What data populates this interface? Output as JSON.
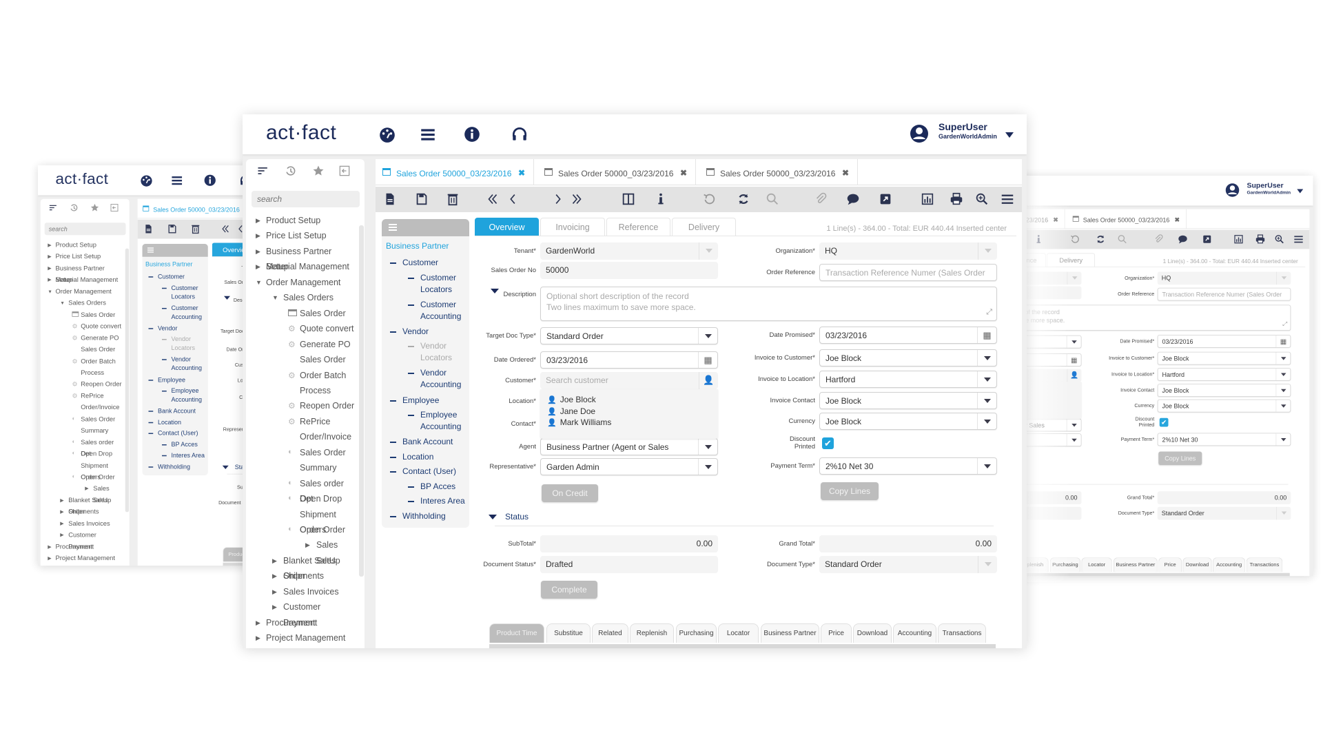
{
  "header": {
    "logo": "act·fact",
    "user_name": "SuperUser",
    "user_role": "GardenWorldAdmin",
    "icons": [
      "dashboard-icon",
      "menu-icon",
      "info-icon",
      "headset-icon"
    ]
  },
  "colors": {
    "accent": "#1fa3dc",
    "navy": "#1b2a5a",
    "button_gray": "#bdbdbd"
  },
  "sidebar": {
    "search_placeholder": "search",
    "tool_icons": [
      "sort-icon",
      "history-icon",
      "star-icon",
      "collapse-icon"
    ],
    "items": [
      {
        "label": "Product Setup",
        "level": 0,
        "icon": "arrow-right"
      },
      {
        "label": "Price List Setup",
        "level": 0,
        "icon": "arrow-right"
      },
      {
        "label": "Business Partner Setup",
        "level": 0,
        "icon": "arrow-right"
      },
      {
        "label": "Material Management",
        "level": 0,
        "icon": "arrow-right"
      },
      {
        "label": "Order Management",
        "level": 0,
        "icon": "arrow-down"
      },
      {
        "label": "Sales Orders",
        "level": 1,
        "icon": "arrow-down"
      },
      {
        "label": "Sales Order",
        "level": 2,
        "icon": "window"
      },
      {
        "label": "Quote convert",
        "level": 2,
        "icon": "gear"
      },
      {
        "label": "Generate PO\nSales Order",
        "level": 2,
        "icon": "gear"
      },
      {
        "label": "Order Batch\nProcess",
        "level": 2,
        "icon": "gear"
      },
      {
        "label": "Reopen Order",
        "level": 2,
        "icon": "gear"
      },
      {
        "label": "RePrice\nOrder/Invoice",
        "level": 2,
        "icon": "gear"
      },
      {
        "label": "Sales Order\nSummary",
        "level": 2,
        "icon": "report"
      },
      {
        "label": "Sales order Det",
        "level": 2,
        "icon": "report"
      },
      {
        "label": "Open Drop\nShipment Orders",
        "level": 2,
        "icon": "report"
      },
      {
        "label": "Open Order",
        "level": 2,
        "icon": "report"
      },
      {
        "label": "Sales SetUp",
        "level": 3,
        "icon": "arrow-right"
      },
      {
        "label": "Blanket Sales Order",
        "level": 1,
        "icon": "arrow-right"
      },
      {
        "label": "Shipments",
        "level": 1,
        "icon": "arrow-right"
      },
      {
        "label": "Sales Invoices",
        "level": 1,
        "icon": "arrow-right"
      },
      {
        "label": "Customer Payment",
        "level": 1,
        "icon": "arrow-right"
      },
      {
        "label": "Procurement",
        "level": 0,
        "icon": "arrow-right"
      },
      {
        "label": "Project Management",
        "level": 0,
        "icon": "arrow-right"
      }
    ]
  },
  "window_tabs": [
    {
      "label": "Sales Order 50000_03/23/2016",
      "active": true
    },
    {
      "label": "Sales Order 50000_03/23/2016",
      "active": false
    },
    {
      "label": "Sales Order 50000_03/23/2016",
      "active": false
    }
  ],
  "toolbar": [
    "new-record-icon",
    "save-icon",
    "delete-icon",
    "first-record-icon",
    "previous-record-icon",
    "next-record-icon",
    "last-record-icon",
    "split-view-icon",
    "info-icon",
    "undo-icon",
    "refresh-icon",
    "search-icon",
    "attachment-icon",
    "chat-icon",
    "zoom-across-icon",
    "report-icon",
    "print-icon",
    "lookup-icon",
    "more-menu-icon"
  ],
  "bp_tree": {
    "title": "Business Partner",
    "items": [
      {
        "label": "Customer",
        "level": 0
      },
      {
        "label": "Customer\nLocators",
        "level": 1
      },
      {
        "label": "Customer\nAccounting",
        "level": 1
      },
      {
        "label": "Vendor",
        "level": 0
      },
      {
        "label": "Vendor\nLocators",
        "level": 1,
        "disabled": true
      },
      {
        "label": "Vendor\nAccounting",
        "level": 1
      },
      {
        "label": "Employee",
        "level": 0
      },
      {
        "label": "Employee\nAccounting",
        "level": 1
      },
      {
        "label": "Bank Account",
        "level": 0
      },
      {
        "label": "Location",
        "level": 0
      },
      {
        "label": "Contact (User)",
        "level": 0
      },
      {
        "label": "BP Acces",
        "level": 1
      },
      {
        "label": "Interes Area",
        "level": 1
      },
      {
        "label": "Withholding",
        "level": 0
      }
    ]
  },
  "form": {
    "tabs": [
      "Overview",
      "Invoicing",
      "Reference",
      "Delivery"
    ],
    "active_tab": "Overview",
    "status_line": "1 Line(s) - 364.00 - Total: EUR 440.44 Inserted center",
    "fields": {
      "tenant": {
        "label": "Tenant*",
        "value": "GardenWorld"
      },
      "sales_order_no": {
        "label": "Sales Order No",
        "value": "50000"
      },
      "organization": {
        "label": "Organization*",
        "value": "HQ"
      },
      "order_reference": {
        "label": "Order Reference",
        "placeholder": "Transaction Reference Numer (Sales Order"
      },
      "description": {
        "label": "Description",
        "placeholder": "Optional short description of the record\nTwo lines maximum to save more space."
      },
      "target_doc_type": {
        "label": "Target Doc Type*",
        "value": "Standard Order"
      },
      "date_ordered": {
        "label": "Date Ordered*",
        "value": "03/23/2016"
      },
      "customer": {
        "label": "Customer*",
        "placeholder": "Search customer",
        "options": [
          "Joe Block",
          "Jane Doe",
          "Mark Williams"
        ]
      },
      "location": {
        "label": "Location*"
      },
      "contact": {
        "label": "Contact*"
      },
      "agent": {
        "label": "Agent",
        "value": "Business Partner (Agent or Sales"
      },
      "representative": {
        "label": "Representative*",
        "value": "Garden Admin"
      },
      "date_promised": {
        "label": "Date Promised*",
        "value": "03/23/2016"
      },
      "invoice_customer": {
        "label": "Invoice to Customer*",
        "value": "Joe Block"
      },
      "invoice_location": {
        "label": "Invoice to Location*",
        "value": "Hartford"
      },
      "invoice_contact": {
        "label": "Invoice Contact",
        "value": "Joe Block"
      },
      "currency": {
        "label": "Currency",
        "value": "Joe Block"
      },
      "discount_printed": {
        "label": "Discount\nPrinted",
        "checked": true
      },
      "payment_term": {
        "label": "Payment Term*",
        "value": "2%10 Net 30"
      }
    },
    "on_credit_label": "On Credit",
    "copy_lines_label": "Copy Lines",
    "status_section": {
      "title": "Status",
      "subtotal": {
        "label": "SubTotal*",
        "value": "0.00"
      },
      "grand_total": {
        "label": "Grand Total*",
        "value": "0.00"
      },
      "document_status": {
        "label": "Document Status*",
        "value": "Drafted"
      },
      "document_type": {
        "label": "Document Type*",
        "value": "Standard Order"
      },
      "complete_label": "Complete"
    },
    "bottom_tabs": [
      "Product Time",
      "Substitue",
      "Related",
      "Replenish",
      "Purchasing",
      "Locator",
      "Business Partner",
      "Price",
      "Download",
      "Accounting",
      "Transactions"
    ],
    "bottom_active": "Product Time"
  }
}
